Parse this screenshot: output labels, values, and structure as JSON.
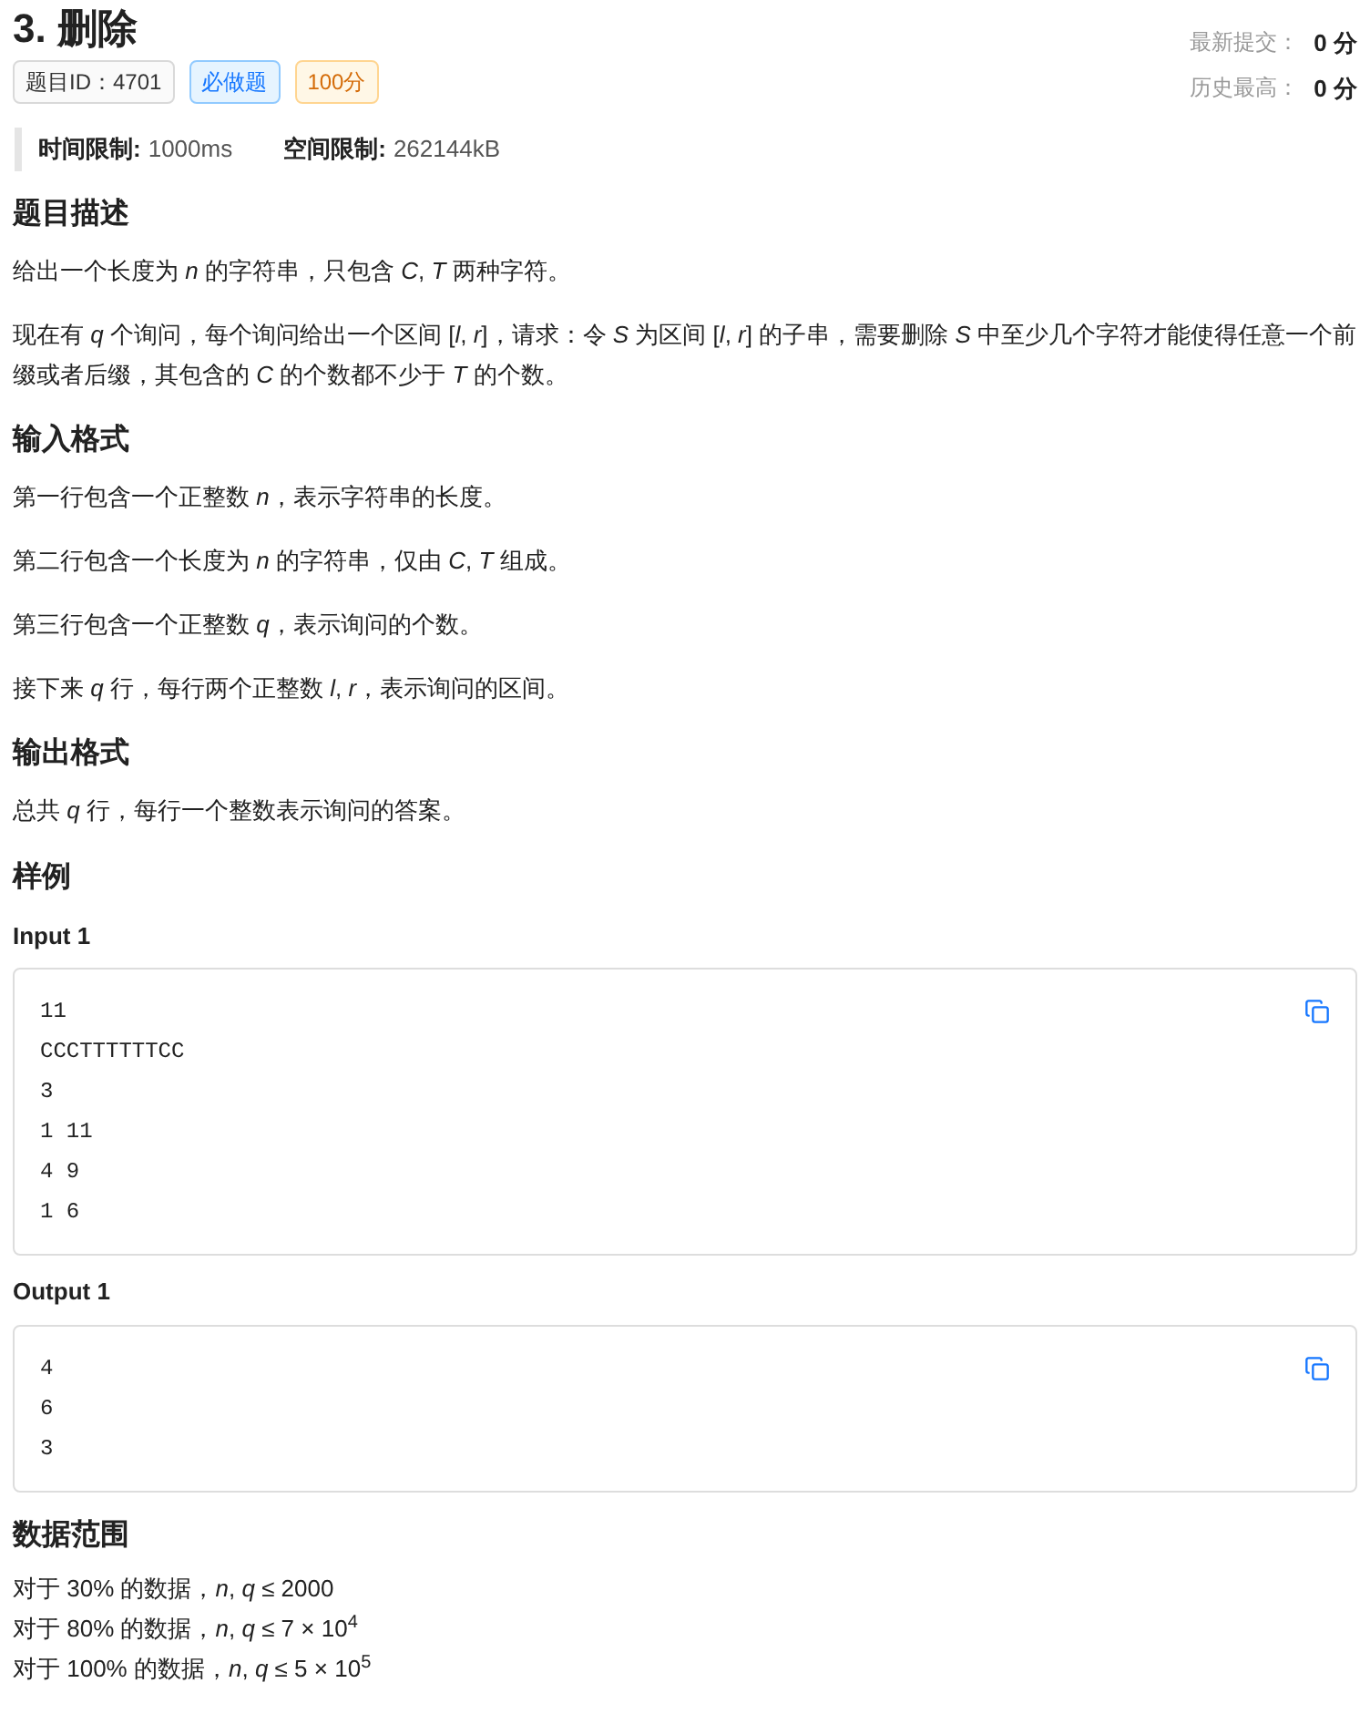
{
  "title": "3. 删除",
  "tags": [
    {
      "label": "题目ID：4701",
      "kind": "neutral"
    },
    {
      "label": "必做题",
      "kind": "required"
    },
    {
      "label": "100分",
      "kind": "score"
    }
  ],
  "scores": [
    {
      "label": "最新提交：",
      "value": "0 分"
    },
    {
      "label": "历史最高：",
      "value": "0 分"
    }
  ],
  "limits": [
    {
      "label": "时间限制:",
      "value": "1000ms"
    },
    {
      "label": "空间限制:",
      "value": "262144kB"
    }
  ],
  "sections": [
    {
      "heading": "题目描述",
      "paragraphs": [
        "给出一个长度为 *n* 的字符串，只包含 *C*, *T* 两种字符。",
        "现在有 *q* 个询问，每个询问给出一个区间 [*l*, *r*]，请求：令 *S* 为区间 [*l*, *r*] 的子串，需要删除 *S* 中至少几个字符才能使得任意一个前缀或者后缀，其包含的 *C* 的个数都不少于 *T* 的个数。"
      ]
    },
    {
      "heading": "输入格式",
      "paragraphs": [
        "第一行包含一个正整数 *n*，表示字符串的长度。",
        "第二行包含一个长度为 *n* 的字符串，仅由 *C*, *T* 组成。",
        "第三行包含一个正整数 *q*，表示询问的个数。",
        "接下来 *q* 行，每行两个正整数 *l*, *r*，表示询问的区间。"
      ]
    },
    {
      "heading": "输出格式",
      "paragraphs": [
        "总共 *q* 行，每行一个整数表示询问的答案。"
      ]
    }
  ],
  "samples_heading": "样例",
  "samples": [
    {
      "label": "Input 1",
      "lines": [
        "11",
        "CCCTTTTTTCC",
        "3",
        "1 11",
        "4 9",
        "1 6"
      ]
    },
    {
      "label": "Output 1",
      "lines": [
        "4",
        "6",
        "3"
      ]
    }
  ],
  "range_heading": "数据范围",
  "range_lines": [
    "对于 30% 的数据，*n*, *q* ≤ 2000",
    "对于 80% 的数据，*n*, *q* ≤ 7 × 10$^{4}$",
    "对于 100% 的数据，*n*, *q* ≤ 5 × 10$^{5}$"
  ]
}
